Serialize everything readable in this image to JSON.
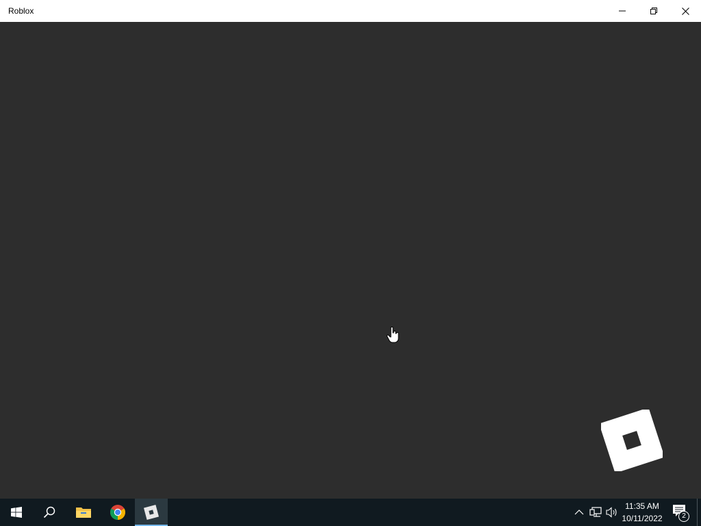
{
  "window": {
    "title": "Roblox",
    "controls": {
      "minimize_icon": "minimize-icon",
      "restore_icon": "restore-icon",
      "close_icon": "close-icon"
    }
  },
  "content": {
    "background": "#2d2d2d",
    "logo": "roblox-logo"
  },
  "taskbar": {
    "background": "#101a20",
    "items": [
      {
        "name": "start-button",
        "icon": "windows-icon"
      },
      {
        "name": "search-button",
        "icon": "search-icon"
      },
      {
        "name": "file-explorer",
        "icon": "folder-icon"
      },
      {
        "name": "chrome",
        "icon": "chrome-icon"
      },
      {
        "name": "roblox",
        "icon": "roblox-icon",
        "active": true
      }
    ],
    "tray": {
      "chevron": "chevron-up-icon",
      "network": "network-icon",
      "volume": "volume-icon",
      "time": "11:35 AM",
      "date": "10/11/2022",
      "notifications_count": "2"
    }
  }
}
